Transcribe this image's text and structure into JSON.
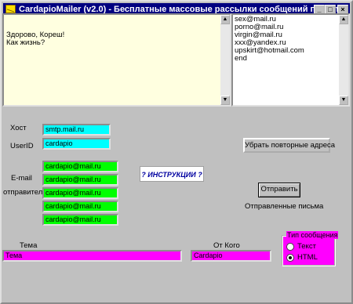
{
  "window": {
    "title": "CardapioMailer (v2.0) - Бесплатные массовые рассылки сообщений по e-mail",
    "minimize": "_",
    "maximize": "□",
    "close": "×"
  },
  "message_body": "Здорово, Кореш!\nКак жизнь?",
  "recipients": [
    "sex@mail.ru",
    "porno@mail.ru",
    "virgin@mail.ru",
    "xxx@yandex.ru",
    "upskirt@hotmail.com",
    "end"
  ],
  "host": {
    "label": "Хост",
    "value": "smtp.mail.ru"
  },
  "userid": {
    "label": "UserID",
    "value": "cardapio"
  },
  "sender": {
    "label_line1": "E-mail",
    "label_line2": "отправителя",
    "values": [
      "cardapio@mail.ru",
      "cardapio@mail.ru",
      "cardapio@mail.ru",
      "cardapio@mail.ru",
      "cardapio@mail.ru"
    ]
  },
  "instructions": "? ИНСТРУКЦИИ ?",
  "remove_duplicates_button": "Убрать повторные адреса",
  "send_button": "Отправить",
  "sent_status": "Отправленные письма",
  "subject": {
    "label": "Тема",
    "value": "Тема"
  },
  "from": {
    "label": "От Кого",
    "value": "Cardapio"
  },
  "message_type": {
    "title": "Тип сообщения",
    "options": [
      "Текст",
      "HTML"
    ],
    "selected": "HTML"
  },
  "colors": {
    "titlebar": "#000080",
    "cyan": "#00ffff",
    "green": "#00ff00",
    "magenta": "#ff00ff",
    "memo": "#ffffe0"
  }
}
